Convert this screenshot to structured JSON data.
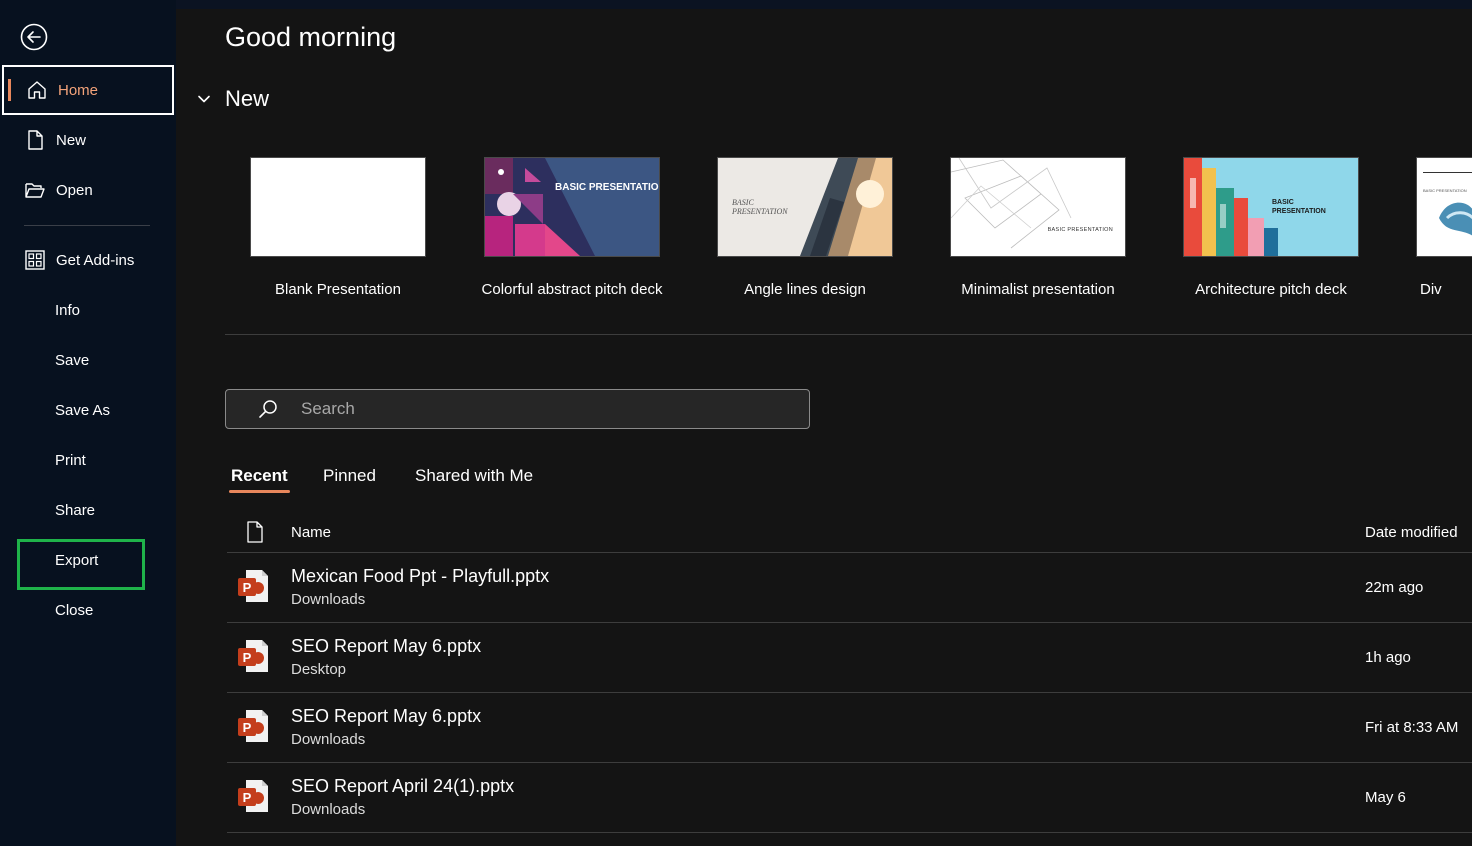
{
  "sidebar": {
    "back_label": "Back",
    "items": [
      {
        "label": "Home",
        "icon": "home-icon"
      },
      {
        "label": "New",
        "icon": "new-file-icon"
      },
      {
        "label": "Open",
        "icon": "folder-open-icon"
      },
      {
        "label": "Get Add-ins",
        "icon": "add-ins-grid-icon"
      },
      {
        "label": "Info"
      },
      {
        "label": "Save"
      },
      {
        "label": "Save As"
      },
      {
        "label": "Print"
      },
      {
        "label": "Share"
      },
      {
        "label": "Export"
      },
      {
        "label": "Close"
      }
    ]
  },
  "main": {
    "greeting": "Good morning",
    "new_section_title": "New",
    "templates": [
      {
        "caption": "Blank Presentation"
      },
      {
        "caption": "Colorful abstract pitch deck",
        "thumb_text": "BASIC PRESENTATION"
      },
      {
        "caption": "Angle lines design",
        "thumb_text": "BASIC PRESENTATION"
      },
      {
        "caption": "Minimalist presentation",
        "thumb_text": "BASIC PRESENTATION"
      },
      {
        "caption": "Architecture pitch deck",
        "thumb_text": "BASIC PRESENTATION"
      },
      {
        "caption": "Div",
        "thumb_text": "BASIC PRESENTATION"
      }
    ],
    "search": {
      "placeholder": "Search"
    },
    "tabs": [
      {
        "label": "Recent",
        "active": true
      },
      {
        "label": "Pinned"
      },
      {
        "label": "Shared with Me"
      }
    ],
    "table": {
      "columns": {
        "name": "Name",
        "date": "Date modified"
      },
      "rows": [
        {
          "name": "Mexican Food Ppt - Playfull.pptx",
          "location": "Downloads",
          "date": "22m ago"
        },
        {
          "name": "SEO Report May 6.pptx",
          "location": "Desktop",
          "date": "1h ago"
        },
        {
          "name": "SEO Report May 6.pptx",
          "location": "Downloads",
          "date": "Fri at 8:33 AM"
        },
        {
          "name": "SEO Report April 24(1).pptx",
          "location": "Downloads",
          "date": "May 6"
        }
      ]
    }
  },
  "colors": {
    "sidebar_bg": "#07111f",
    "main_bg": "#141414",
    "accent": "#e8875c",
    "highlight_box": "#1fb34a",
    "powerpoint_red": "#c43e1c"
  }
}
